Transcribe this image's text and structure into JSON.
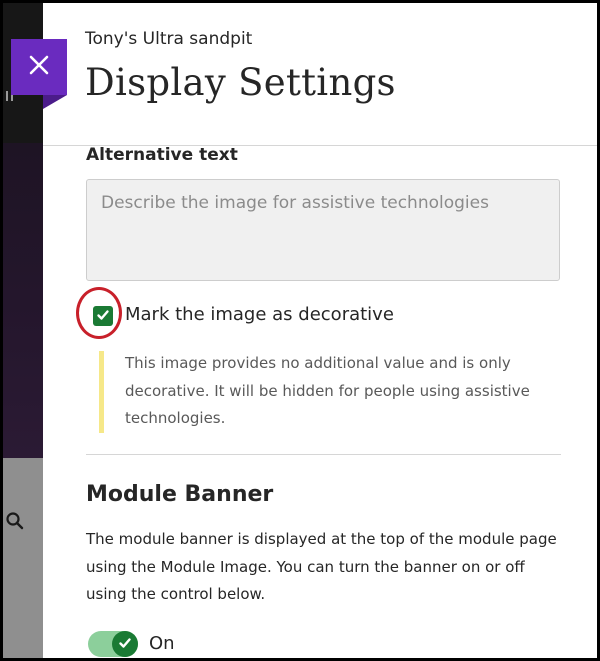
{
  "header": {
    "course_name": "Tony's Ultra sandpit",
    "title": "Display Settings"
  },
  "alt_text": {
    "label": "Alternative text",
    "placeholder": "Describe the image for assistive technologies",
    "value": ""
  },
  "decorative": {
    "label": "Mark the image as decorative",
    "checked": true,
    "help": "This image provides no additional value and is only decorative. It will be hidden for people using assistive technologies."
  },
  "module_banner": {
    "title": "Module Banner",
    "description": "The module banner is displayed at the top of the module page using the Module Image. You can turn the banner on or off using the control below.",
    "toggle_state": "On",
    "toggle_on": true
  },
  "icons": {
    "close": "close-icon",
    "checkbox_check": "checkmark-icon",
    "toggle_check": "checkmark-icon",
    "background_search": "search-icon"
  },
  "colors": {
    "close_button": "#6a2bbf",
    "checkbox": "#1a7a34",
    "toggle_track": "#8ccf9b",
    "toggle_knob": "#1a7a34",
    "help_bar": "#f6e889",
    "annotation_circle": "#c8202a"
  }
}
